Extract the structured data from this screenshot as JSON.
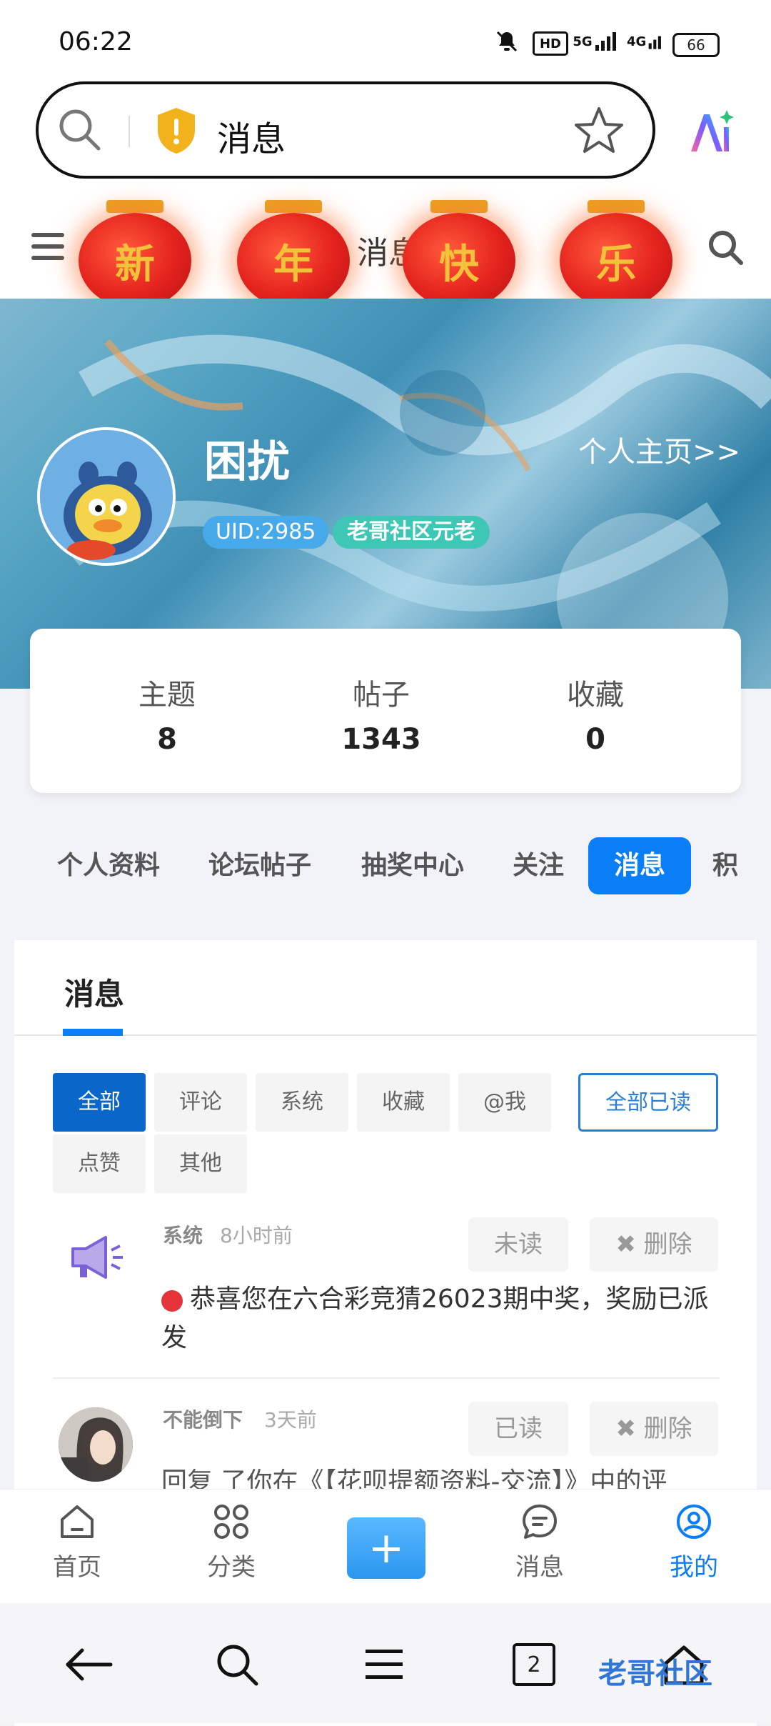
{
  "status_bar": {
    "time": "06:22",
    "battery": "66",
    "icons": [
      "mute-icon",
      "hd-icon",
      "5g-signal-icon",
      "4g-signal-icon"
    ],
    "hd": "HD",
    "net1": "5G",
    "net2": "4G"
  },
  "browser": {
    "url_text": "消息",
    "icons": [
      "search-icon",
      "shield-warning-icon",
      "star-icon",
      "ai-icon"
    ]
  },
  "site_header": {
    "title": "消息",
    "lanterns": [
      "新",
      "年",
      "快",
      "乐"
    ]
  },
  "profile": {
    "username": "困扰",
    "homepage_link": "个人主页>>",
    "uid": "UID:2985",
    "level": "老哥社区元老"
  },
  "stats": [
    {
      "label": "主题",
      "value": "8"
    },
    {
      "label": "帖子",
      "value": "1343"
    },
    {
      "label": "收藏",
      "value": "0"
    }
  ],
  "nav_tabs": [
    "个人资料",
    "论坛帖子",
    "抽奖中心",
    "关注",
    "消息",
    "积"
  ],
  "messages_panel": {
    "title": "消息",
    "filters": [
      "全部",
      "评论",
      "系统",
      "收藏",
      "@我",
      "点赞",
      "其他"
    ],
    "mark_all_read": "全部已读",
    "items": [
      {
        "sender": "系统",
        "time": "8小时前",
        "status_button": "未读",
        "delete_button": "✖ 删除",
        "text": "恭喜您在六合彩竞猜26023期中奖，奖励已派发"
      },
      {
        "sender": "不能倒下",
        "time": "3天前",
        "status_button": "已读",
        "delete_button": "✖ 删除",
        "text": "回复 了你在《【花呗提额资料-交流】》中的评"
      }
    ]
  },
  "site_nav": [
    {
      "label": "首页",
      "icon": "home-icon"
    },
    {
      "label": "分类",
      "icon": "grid-icon"
    },
    {
      "label": "+",
      "icon": "add-icon"
    },
    {
      "label": "消息",
      "icon": "chat-icon"
    },
    {
      "label": "我的",
      "icon": "user-icon"
    }
  ],
  "system_nav": {
    "tab_count": "2",
    "watermark": "老哥社区"
  },
  "colors": {
    "accent": "#0a7ef5",
    "filter_active": "#0a66c8",
    "lantern_red": "#e4221d"
  }
}
